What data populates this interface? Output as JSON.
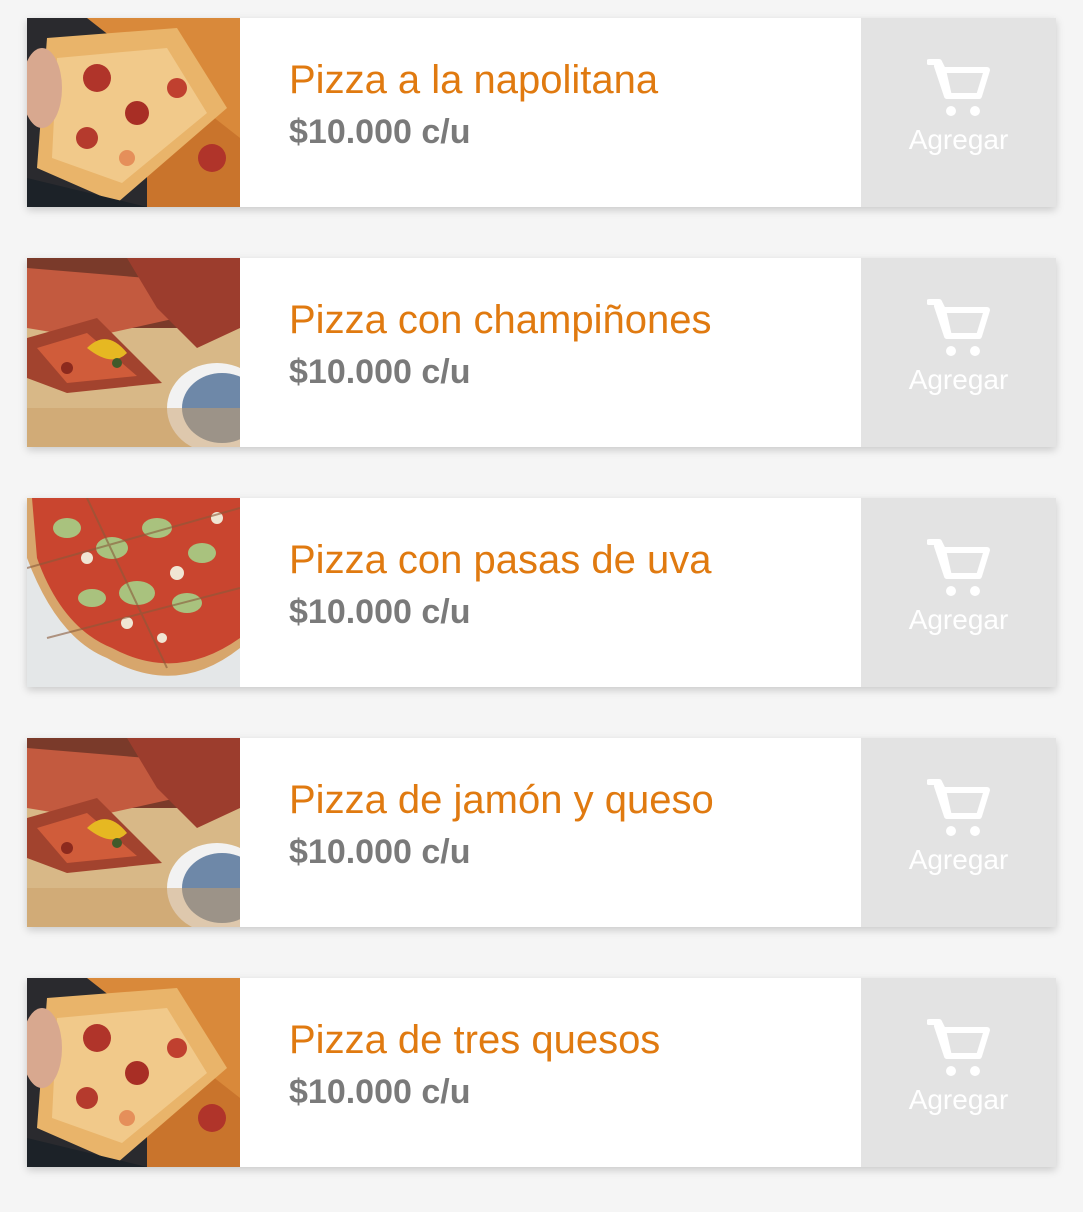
{
  "products": [
    {
      "name": "Pizza a la napolitana",
      "price": "$10.000 c/u",
      "add_label": "Agregar",
      "image": "pizza-slice-pepperoni-photo"
    },
    {
      "name": "Pizza con champiñones",
      "price": "$10.000 c/u",
      "add_label": "Agregar",
      "image": "pizza-slices-board-photo"
    },
    {
      "name": "Pizza con pasas de uva",
      "price": "$10.000 c/u",
      "add_label": "Agregar",
      "image": "pizza-zucchini-photo"
    },
    {
      "name": "Pizza de jamón y queso",
      "price": "$10.000 c/u",
      "add_label": "Agregar",
      "image": "pizza-slices-board-photo"
    },
    {
      "name": "Pizza de tres quesos",
      "price": "$10.000 c/u",
      "add_label": "Agregar",
      "image": "pizza-slice-pepperoni-photo"
    }
  ],
  "colors": {
    "accent": "#e07a10",
    "price": "#7a7a7a",
    "button_bg": "#e3e3e3",
    "button_fg": "#ffffff"
  },
  "icons": {
    "cart": "cart-icon"
  }
}
